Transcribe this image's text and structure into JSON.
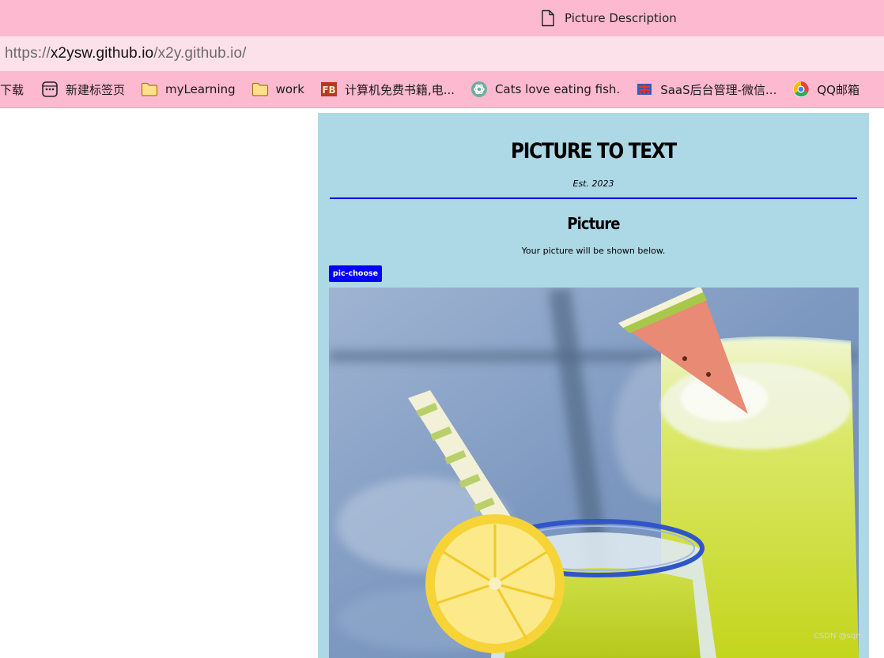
{
  "browser": {
    "tab_title": "Picture Description",
    "url_scheme": "https://",
    "url_host": "x2ysw.github.io",
    "url_path": "/x2y.github.io/",
    "bookmarks": [
      {
        "label": "下载",
        "icon": "download"
      },
      {
        "label": "新建标签页",
        "icon": "new-tab-icon"
      },
      {
        "label": "myLearning",
        "icon": "folder-icon"
      },
      {
        "label": "work",
        "icon": "folder-icon"
      },
      {
        "label": "计算机免费书籍,电...",
        "icon": "fb-logo-icon"
      },
      {
        "label": "Cats love eating fish.",
        "icon": "openai-icon"
      },
      {
        "label": "SaaS后台管理-微信...",
        "icon": "saas-logo-icon"
      },
      {
        "label": "QQ邮箱",
        "icon": "qq-mail-icon"
      }
    ]
  },
  "page": {
    "site_title": "PICTURE TO TEXT",
    "est": "Est. 2023",
    "section_title": "Picture",
    "section_subtitle": "Your picture will be shown below.",
    "choose_button": "pic-choose",
    "photo_alt": "Lemon and watermelon slushie drinks"
  },
  "watermark": "CSDN @sqm",
  "colors": {
    "chrome_pink": "#fdb9d0",
    "address_pink": "#fde1ea",
    "panel_blue": "#add8e6",
    "rule_blue": "#0000ee",
    "button_blue": "#0000ff"
  }
}
